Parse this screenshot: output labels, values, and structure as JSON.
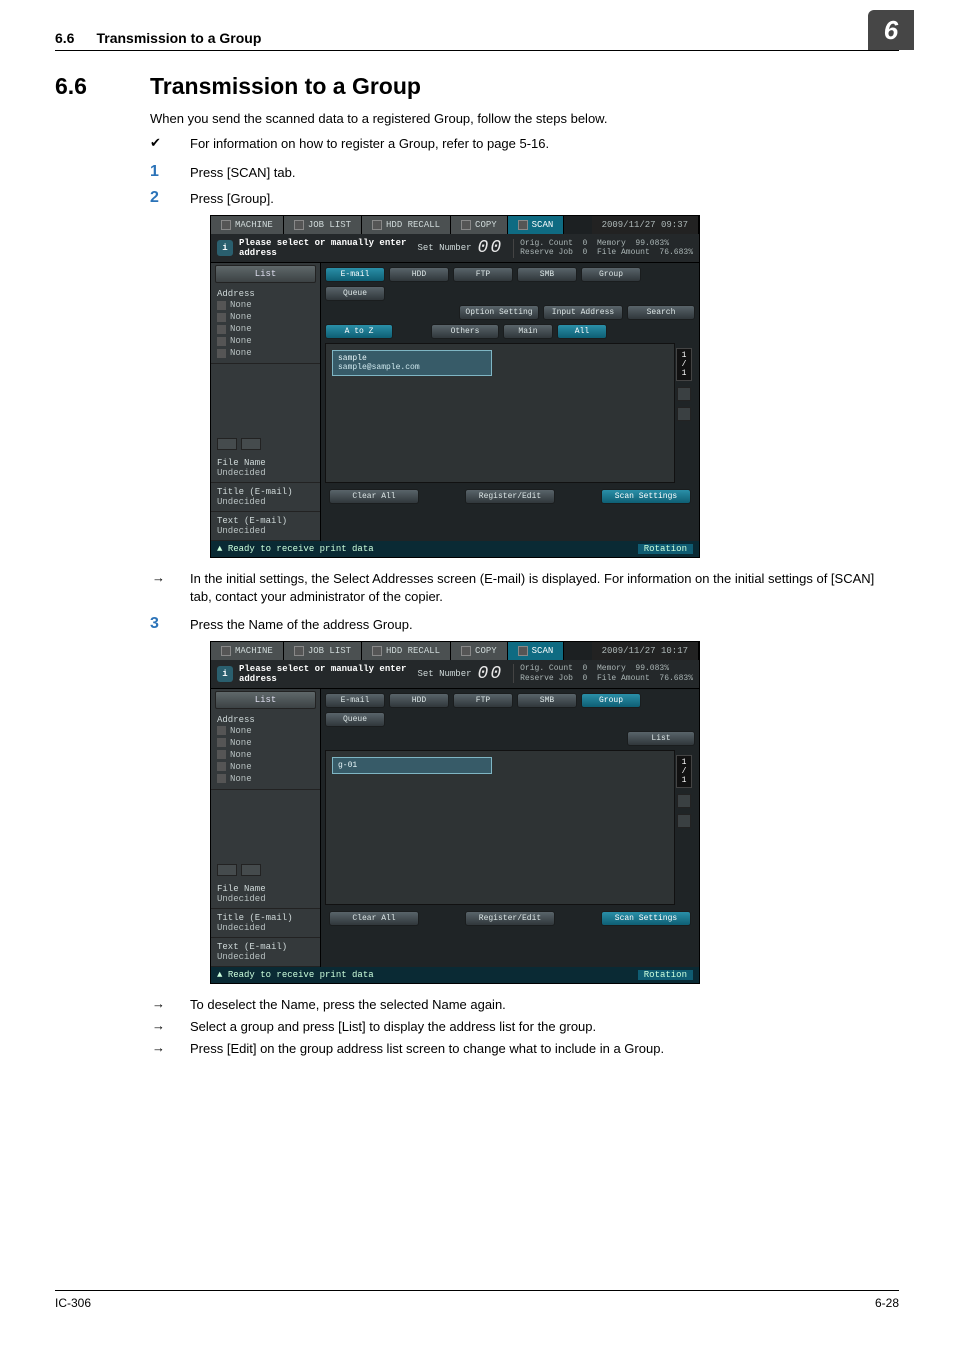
{
  "header": {
    "section": "6.6",
    "title": "Transmission to a Group",
    "chapter": "6"
  },
  "h1": "Transmission to a Group",
  "intro": "When you send the scanned data to a registered Group, follow the steps below.",
  "note": "For information on how to register a Group, refer to page 5-16.",
  "steps": {
    "s1": "Press [SCAN] tab.",
    "s2": "Press [Group].",
    "s2_sub": "In the initial settings, the Select Addresses screen (E-mail) is displayed.  For information on the initial settings of [SCAN] tab, contact your administrator of the copier.",
    "s3": "Press the Name of the address Group.",
    "s3_sub1": "To deselect the Name, press the selected Name again.",
    "s3_sub2": "Select a group and press [List] to display the address list for the group.",
    "s3_sub3": "Press [Edit] on the group address list screen to change what to include in a Group."
  },
  "panel": {
    "tabs": {
      "machine": "MACHINE",
      "joblist": "JOB LIST",
      "hdd": "HDD RECALL",
      "copy": "COPY",
      "scan": "SCAN"
    },
    "dt1": "2009/11/27 09:37",
    "dt2": "2009/11/27 10:17",
    "msg": "Please select or manually enter address",
    "setnum_lab": "Set Number",
    "setnum_val": "00",
    "counters": {
      "oc": "Orig. Count",
      "oc_v": "0",
      "rj": "Reserve Job",
      "rj_v": "0",
      "mem": "Memory",
      "mem_v": "99.083%",
      "fa": "File Amount",
      "fa_v": "76.683%"
    },
    "side": {
      "list": "List",
      "address": "Address",
      "none": "None",
      "filename": "File Name",
      "und": "Undecided",
      "titlee": "Title (E-mail)",
      "texte": "Text (E-mail)"
    },
    "types": {
      "email": "E-mail",
      "hdd": "HDD",
      "ftp": "FTP",
      "smb": "SMB",
      "group": "Group",
      "queue": "Queue"
    },
    "acts": {
      "optset": "Option Setting",
      "inpadd": "Input Address",
      "search": "Search",
      "listb": "List",
      "atoz": "A to Z",
      "others": "Others",
      "main": "Main",
      "all": "All",
      "clear": "Clear All",
      "regedit": "Register/Edit",
      "scanset": "Scan Settings"
    },
    "card1": {
      "name": "sample",
      "addr": "sample@sample.com"
    },
    "card2": {
      "name": "g-01"
    },
    "scroll": "1\n/\n1",
    "status": "Ready to receive print data",
    "rot": "Rotation"
  },
  "footer": {
    "left": "IC-306",
    "right": "6-28"
  }
}
